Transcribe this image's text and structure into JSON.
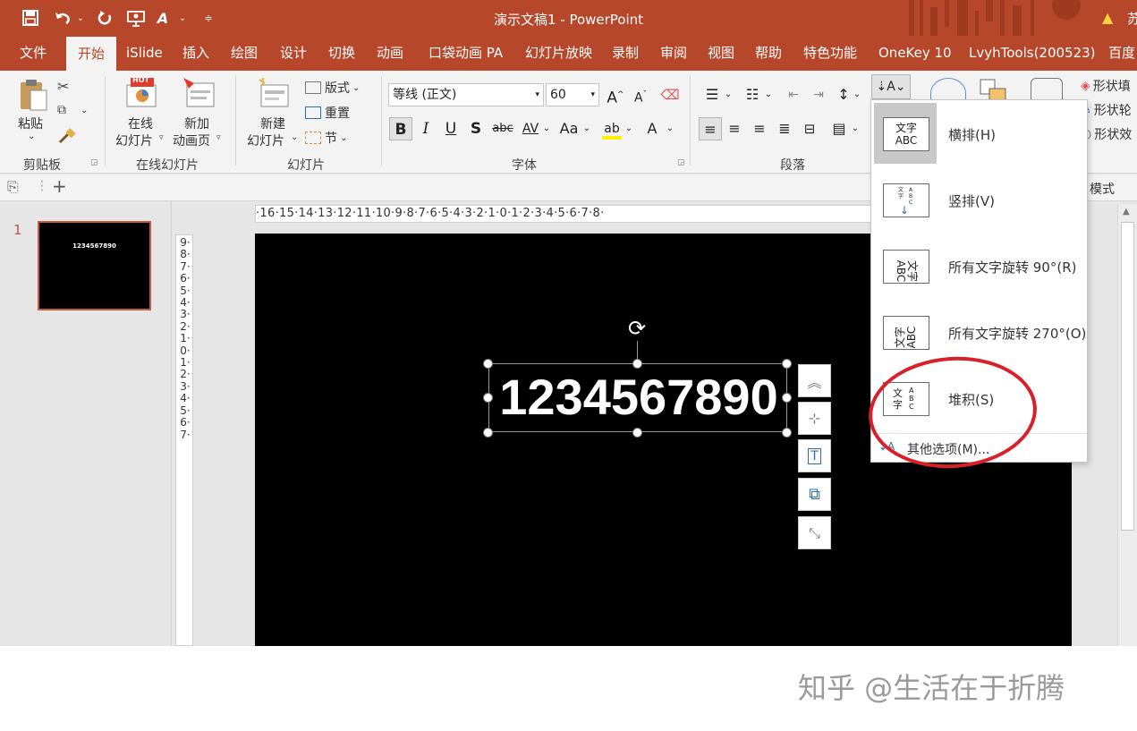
{
  "window": {
    "title": "演示文稿1 - PowerPoint",
    "user_fragment": "苏"
  },
  "qat": {
    "save_icon": "save-icon",
    "undo_icon": "undo-icon",
    "redo_icon": "redo-icon",
    "present_icon": "present-from-start-icon",
    "draw_icon": "draw-icon",
    "customize_icon": "customize-qat-icon"
  },
  "tabs": [
    {
      "label": "文件"
    },
    {
      "label": "开始"
    },
    {
      "label": "iSlide"
    },
    {
      "label": "插入"
    },
    {
      "label": "绘图"
    },
    {
      "label": "设计"
    },
    {
      "label": "切换"
    },
    {
      "label": "动画"
    },
    {
      "label": "口袋动画 PA"
    },
    {
      "label": "幻灯片放映"
    },
    {
      "label": "录制"
    },
    {
      "label": "审阅"
    },
    {
      "label": "视图"
    },
    {
      "label": "帮助"
    },
    {
      "label": "特色功能"
    },
    {
      "label": "OneKey 10"
    },
    {
      "label": "LvyhTools(200523)"
    },
    {
      "label": "百度"
    }
  ],
  "ribbon": {
    "clipboard": {
      "paste": "粘贴",
      "group": "剪贴板"
    },
    "online": {
      "online_slide": "在线",
      "online_slide2": "幻灯片",
      "new_anim": "新加",
      "new_anim2": "动画页",
      "group": "在线幻灯片",
      "hot": "HOT"
    },
    "slides": {
      "new_slide": "新建",
      "new_slide2": "幻灯片",
      "layout": "版式",
      "reset": "重置",
      "section": "节",
      "group": "幻灯片"
    },
    "font": {
      "family": "等线 (正文)",
      "size": "60",
      "group": "字体",
      "bold": "B",
      "italic": "I",
      "underline": "U",
      "shadow": "S",
      "strike": "abc",
      "spacing": "AV",
      "case": "Aa",
      "color": "A",
      "grow": "A",
      "shrink": "A"
    },
    "paragraph": {
      "group": "段落"
    },
    "shape": {
      "fill": "形状填",
      "outline": "形状轮",
      "effect": "形状效",
      "styles": "模式"
    }
  },
  "thumbnail": {
    "number": "1",
    "text": "1234567890"
  },
  "ruler": {
    "horizontal": "·16·15·14·13·12·11·10·9·8·7·6·5·4·3·2·1·0·1·2·3·4·5·6·7·8·",
    "vertical": "9·8·7·6·5·4·3·2·1·0·1·2·3·4·5·6·7·"
  },
  "slide": {
    "text": "1234567890"
  },
  "text_direction_menu": {
    "items": [
      {
        "label": "横排(H)",
        "icon": "horizontal-text-icon",
        "icon_text": "文字\nABC",
        "selected": true
      },
      {
        "label": "竖排(V)",
        "icon": "vertical-text-icon",
        "icon_text": "",
        "selected": false
      },
      {
        "label": "所有文字旋转 90°(R)",
        "icon": "rotate-90-icon",
        "icon_text": "文字\nABC",
        "selected": false
      },
      {
        "label": "所有文字旋转 270°(O)",
        "icon": "rotate-270-icon",
        "icon_text": "文字\nABC",
        "selected": false
      },
      {
        "label": "堆积(S)",
        "icon": "stacked-text-icon",
        "icon_text": "文字",
        "selected": false
      }
    ],
    "more": "其他选项(M)..."
  },
  "annotation": {
    "circle_color": "#d9202a"
  },
  "watermark": "知乎 @生活在于折腾",
  "colors": {
    "accent": "#b7472a",
    "ribbon": "#f3f3f3",
    "slide_bg": "#000000"
  }
}
